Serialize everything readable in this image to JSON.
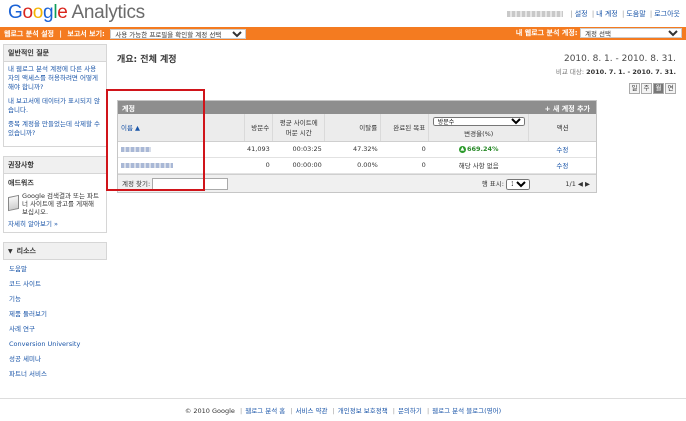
{
  "header": {
    "logo_google": [
      "G",
      "o",
      "o",
      "g",
      "l",
      "e"
    ],
    "logo_product": "Analytics",
    "links": [
      "설정",
      "내 계정",
      "도움말",
      "로그아웃"
    ]
  },
  "nav": {
    "left_label_1": "웹로그 분석 설정",
    "left_label_2": "보고서 보기:",
    "report_select": "사용 가능한 프로필을 확인할 계정 선택",
    "right_label": "내 웹로그 분석 계정:",
    "account_select": "계정 선택"
  },
  "sidebar": {
    "faq_title": "일반적인 질문",
    "faq_items": [
      "내 웹로그 분석 계정에 다른 사용자의 액세스를 허용하려면 어떻게 해야 합니까?",
      "내 보고서에 데이터가 표시되지 않습니다.",
      "중복 계정을 만들었는데 삭제할 수 있습니까?"
    ],
    "recommend_title": "권장사항",
    "hardware_title": "애드워즈",
    "hardware_text": "Google 검색결과 또는 파트너 사이트에 광고를 게재해 보십시오.",
    "hardware_link": "자세히 알아보기 »",
    "resources_title": "리소스",
    "resources": [
      "도움말",
      "코드 사이트",
      "기능",
      "제품 둘러보기",
      "사례 연구",
      "Conversion University",
      "성공 세미나",
      "파트너 서비스"
    ]
  },
  "main": {
    "title": "개요: 전체 계정",
    "date_range": "2010. 8. 1. - 2010. 8. 31.",
    "compare_label": "비교 대상:",
    "compare_range": "2010. 7. 1. - 2010. 7. 31.",
    "view_buttons": [
      "일",
      "주",
      "월",
      "연"
    ],
    "view_active_index": 2
  },
  "accounts_panel": {
    "title": "계정",
    "add_label": "+ 새 계정 추가",
    "columns": {
      "name": "이름 ▲",
      "visits": "방문수",
      "time": "평균 사이트에 머문 시간",
      "bounce": "이탈률",
      "goals": "완료된 목표",
      "metric_select": "방문수",
      "change": "변경율(%)",
      "action": "액션"
    },
    "rows": [
      {
        "visits": "41,093",
        "time": "00:03:25",
        "bounce": "47.32%",
        "goals": "0",
        "change": "669.24%",
        "action": "수정"
      },
      {
        "visits": "0",
        "time": "00:00:00",
        "bounce": "0.00%",
        "goals": "0",
        "change": "해당 사항 없음",
        "action": "수정"
      }
    ],
    "search_label": "계정 찾기:",
    "rows_label": "행 표시:",
    "rows_value": "10",
    "pager": "1/1 ◀ ▶"
  },
  "footer": {
    "copyright": "© 2010 Google",
    "links": [
      "웹로그 분석 홈",
      "서비스 약관",
      "개인정보 보호정책",
      "문의하기",
      "웹로그 분석 블로그(영어)"
    ]
  },
  "colors": {
    "brand_orange": "#f47b20",
    "link": "#1a55a8",
    "positive": "#2a8a2a",
    "highlight": "#d0141a"
  }
}
